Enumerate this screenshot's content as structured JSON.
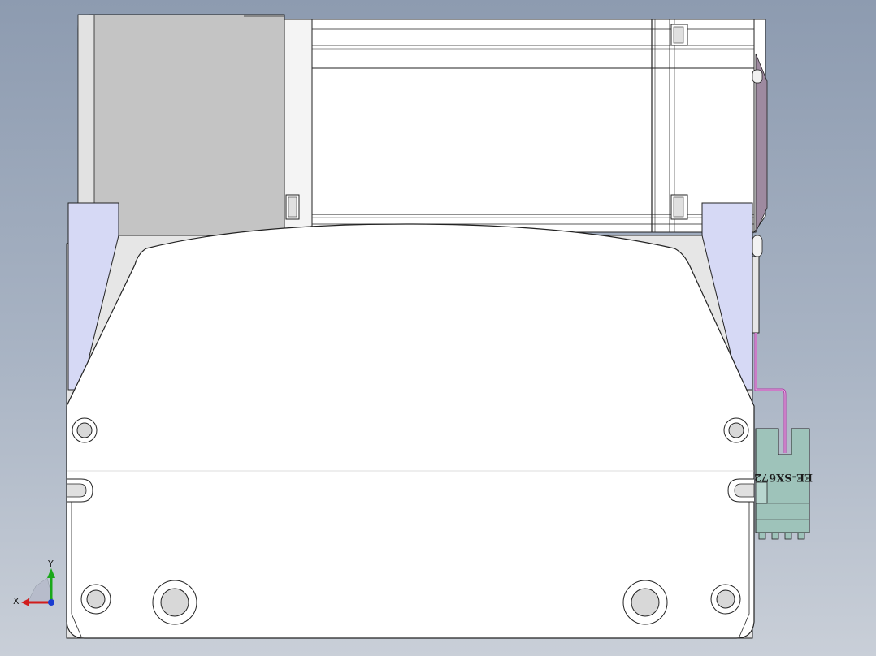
{
  "viewport": {
    "background_top": "#8d9bb0",
    "background_bottom": "#c9cfd8"
  },
  "model": {
    "part_label": "EE-SX672",
    "colors": {
      "body_fill": "#ffffff",
      "motor_fill": "#c4c4c4",
      "bracket_fill": "#d6d9f5",
      "sensor_fill": "#9ec3ba",
      "cable_color": "#b03fa8",
      "outline": "#222222"
    }
  },
  "triad": {
    "x_label": "X",
    "y_label": "Y",
    "x_color": "#d11c1c",
    "y_color": "#1aa81a",
    "z_color": "#1a3cd1"
  }
}
